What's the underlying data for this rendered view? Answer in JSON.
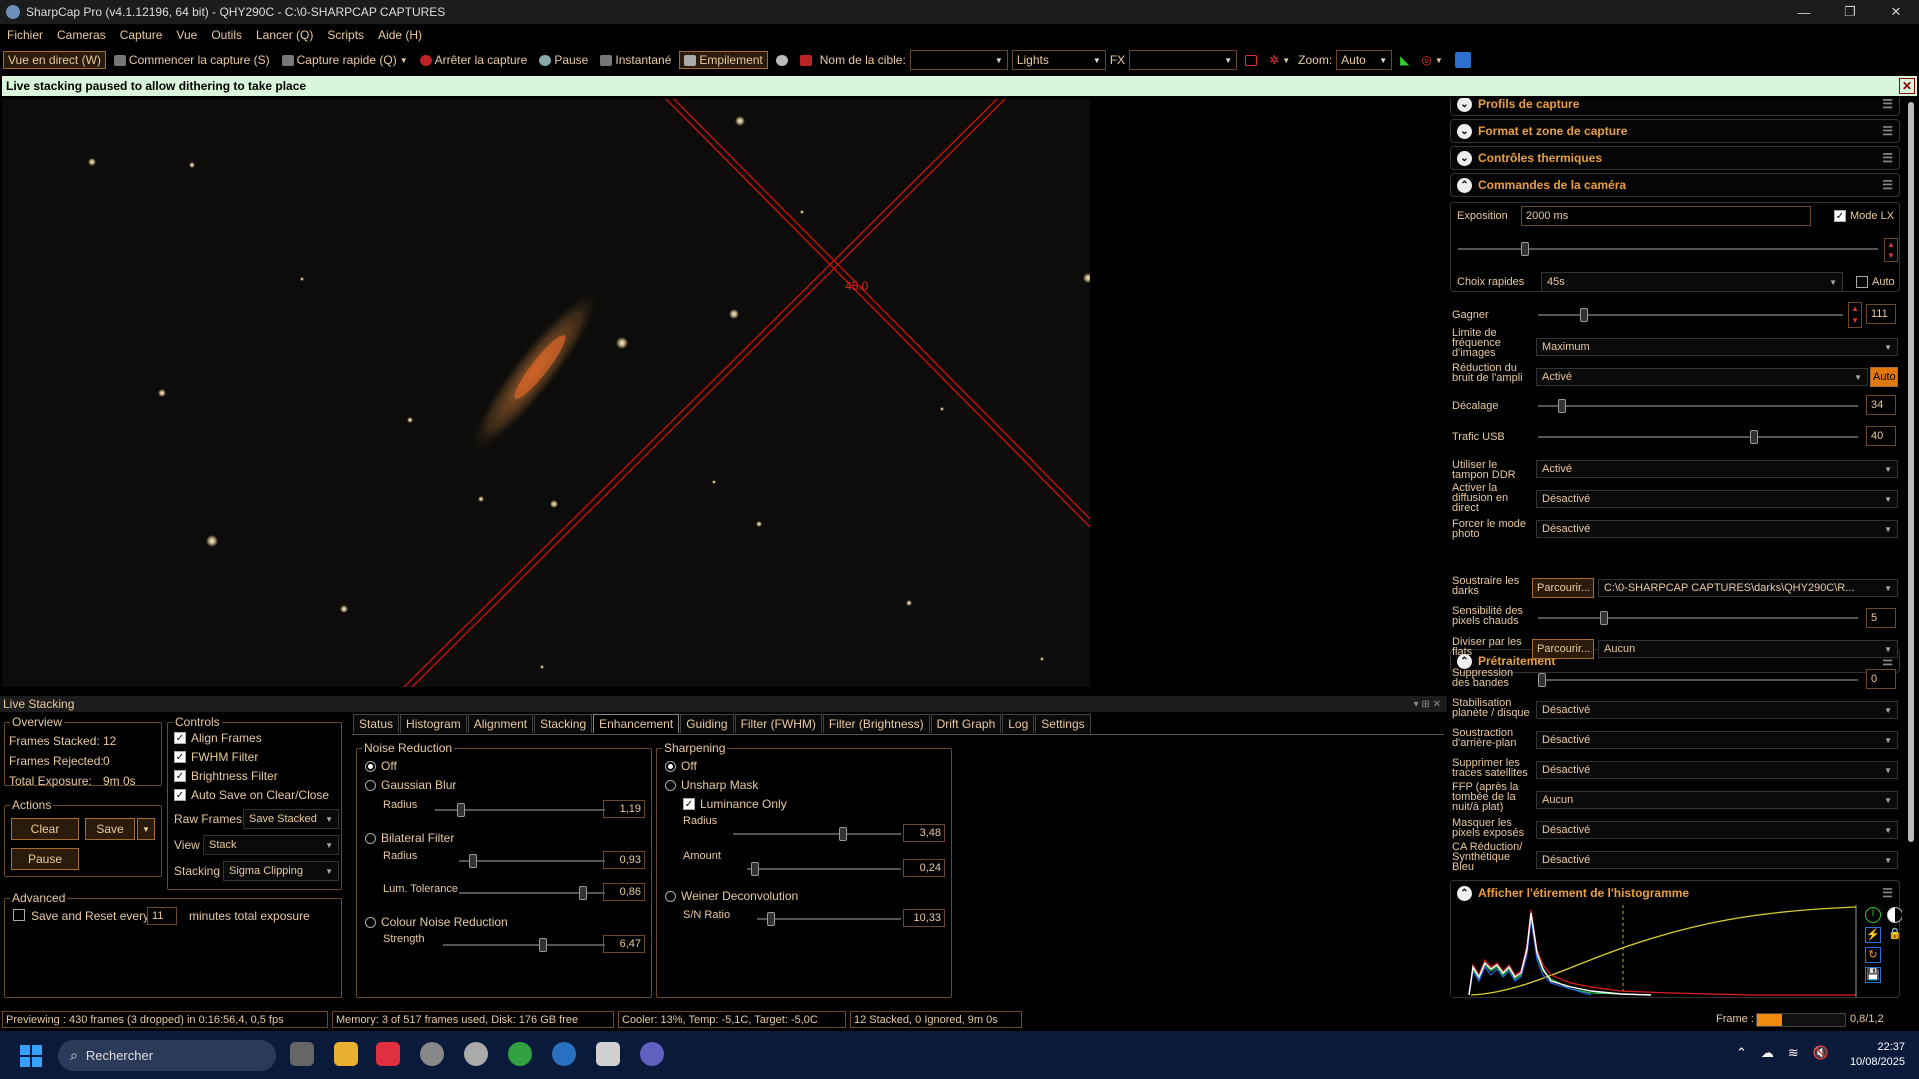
{
  "window": {
    "title": "SharpCap Pro (v4.1.12196, 64 bit) - QHY290C - C:\\0-SHARPCAP CAPTURES",
    "controls": [
      "—",
      "❐",
      "✕"
    ]
  },
  "menu": [
    "Fichier",
    "Cameras",
    "Capture",
    "Vue",
    "Outils",
    "Lancer (Q)",
    "Scripts",
    "Aide (H)"
  ],
  "toolbar": {
    "live_view": "Vue en direct (W)",
    "start_capture": "Commencer la capture (S)",
    "quick_capture": "Capture rapide (Q)",
    "stop_capture": "Arrêter la capture",
    "pause": "Pause",
    "snapshot": "Instantané",
    "stacking": "Empilement",
    "target_label": "Nom de la cible:",
    "target_value": "",
    "frame_type": "Lights",
    "fx_label": "FX",
    "fx_value": "",
    "zoom_label": "Zoom:",
    "zoom_value": "Auto"
  },
  "notification": {
    "text": "Live stacking paused to allow dithering to take place"
  },
  "viewer": {
    "angle_label": "45.0"
  },
  "right_panel": {
    "sections": {
      "capture_profiles": "Profils de capture",
      "capture_format": "Format et zone de capture",
      "thermal": "Contrôles thermiques",
      "camera": "Commandes de la caméra",
      "preprocessing": "Prétraitement",
      "histogram": "Afficher l'étirement de l'histogramme"
    },
    "camera": {
      "exposure_label": "Exposition",
      "exposure_value": "2000 ms",
      "lx_mode_label": "Mode LX",
      "quick_choice_label": "Choix rapides",
      "quick_choice_value": "45s",
      "auto_label": "Auto",
      "gain_label": "Gagner",
      "gain_value": "111",
      "frame_rate_label": "Limite de fréquence d'images",
      "frame_rate_value": "Maximum",
      "amp_noise_label": "Réduction du bruit de l'ampli",
      "amp_noise_value": "Activé",
      "amp_auto": "Auto",
      "offset_label": "Décalage",
      "offset_value": "34",
      "usb_label": "Trafic USB",
      "usb_value": "40",
      "ddr_label": "Utiliser le tampon DDR",
      "ddr_value": "Activé",
      "broadcast_label": "Activer la diffusion en direct",
      "broadcast_value": "Désactivé",
      "photo_label": "Forcer le mode photo",
      "photo_value": "Désactivé"
    },
    "preproc": {
      "darks_label": "Soustraire les darks",
      "browse": "Parcourir...",
      "darks_path": "C:\\0-SHARPCAP CAPTURES\\darks\\QHY290C\\R...",
      "hot_label": "Sensibilité des pixels chauds",
      "hot_value": "5",
      "flats_label": "Diviser par les flats",
      "flats_value": "Aucun",
      "banding_label": "Suppression des bandes",
      "banding_value": "0",
      "stab_label": "Stabilisation planète / disque",
      "stab_value": "Désactivé",
      "bg_label": "Soustraction d'arrière-plan",
      "bg_value": "Désactivé",
      "sat_label": "Supprimer les traces satellites",
      "sat_value": "Désactivé",
      "ffp_label": "FFP (après la tombée de la nuit/à plat)",
      "ffp_value": "Aucun",
      "mask_label": "Masquer les pixels exposés",
      "mask_value": "Désactivé",
      "ca_label": "CA Réduction/ Synthétique Bleu",
      "ca_value": "Désactivé"
    }
  },
  "live_stacking": {
    "title": "Live Stacking",
    "overview": {
      "title": "Overview",
      "frames_stacked_label": "Frames Stacked:",
      "frames_stacked": "12",
      "frames_rejected_label": "Frames Rejected:",
      "frames_rejected": "0",
      "total_exposure_label": "Total Exposure:",
      "total_exposure": "9m 0s"
    },
    "actions": {
      "title": "Actions",
      "clear": "Clear",
      "save": "Save",
      "pause": "Pause"
    },
    "advanced": {
      "title": "Advanced",
      "save_reset": "Save and Reset every",
      "minutes_value": "11",
      "minutes_suffix": "minutes total exposure"
    },
    "controls": {
      "title": "Controls",
      "align": "Align Frames",
      "fwhm": "FWHM Filter",
      "brightness": "Brightness Filter",
      "autosave": "Auto Save on Clear/Close",
      "raw_frames_label": "Raw Frames",
      "raw_frames_value": "Save Stacked",
      "view_label": "View",
      "view_value": "Stack",
      "stacking_label": "Stacking",
      "stacking_value": "Sigma Clipping"
    },
    "tabs": [
      "Status",
      "Histogram",
      "Alignment",
      "Stacking",
      "Enhancement",
      "Guiding",
      "Filter (FWHM)",
      "Filter (Brightness)",
      "Drift Graph",
      "Log",
      "Settings"
    ],
    "active_tab": "Enhancement",
    "noise": {
      "title": "Noise Reduction",
      "off": "Off",
      "gaussian": "Gaussian Blur",
      "radius": "Radius",
      "gaussian_radius": "1,19",
      "bilateral": "Bilateral Filter",
      "bilateral_radius": "0,93",
      "lum_tol": "Lum. Tolerance",
      "lum_tol_value": "0,86",
      "colour": "Colour Noise Reduction",
      "strength": "Strength",
      "strength_value": "6,47"
    },
    "sharpen": {
      "title": "Sharpening",
      "off": "Off",
      "unsharp": "Unsharp Mask",
      "lum_only": "Luminance Only",
      "radius": "Radius",
      "radius_value": "3,48",
      "amount": "Amount",
      "amount_value": "0,24",
      "weiner": "Weiner Deconvolution",
      "sn": "S/N Ratio",
      "sn_value": "10,33"
    }
  },
  "status_bar": {
    "preview": "Previewing : 430 frames (3 dropped) in 0:16:56,4, 0,5 fps",
    "memory": "Memory: 3 of 517 frames used, Disk: 176 GB free",
    "cooler": "Cooler: 13%, Temp: -5,1C, Target: -5,0C",
    "stacked": "12 Stacked, 0 Ignored, 9m 0s",
    "frame_label": "Frame :",
    "frame_value": "0,8/1,2",
    "frame_progress": 0.28
  },
  "taskbar": {
    "search": "Rechercher",
    "time": "22:37",
    "date": "10/08/2025"
  },
  "colors": {
    "accent": "#e8a040",
    "text": "#e8c9a0",
    "notify_bg": "#d9f5dc",
    "taskbar": "#0a1a3a"
  }
}
